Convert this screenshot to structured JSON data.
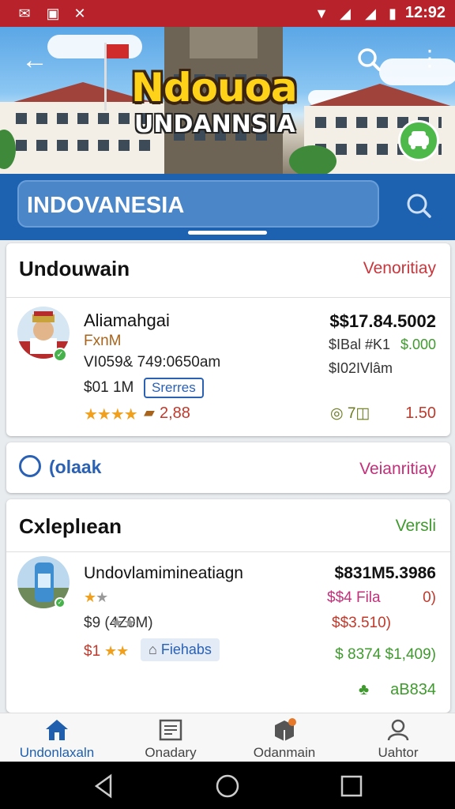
{
  "status_bar": {
    "time": "12:92"
  },
  "hero": {
    "title": "Ndouoa",
    "subtitle": "UNDANNSIA"
  },
  "search": {
    "value": "INDOVANESIA"
  },
  "cards": [
    {
      "header": "Undouwain",
      "side": "Venoritiay",
      "side_color": "#c8363c",
      "item": {
        "name": "Aliamahgai",
        "sub": "FxnM",
        "meta": "VI059&  749:0650am",
        "price_small": "$01 1M",
        "tag": "Srerres",
        "rating_text": "2,88",
        "price_big": "$$17.84.5002",
        "price_row2_a": "$IBal #K1",
        "price_row2_b": "$.000",
        "price_row3": "$I02IVlâm",
        "icons_text": "◎ 7◫",
        "value_right": "1.50"
      }
    },
    {
      "header": "(olaak",
      "side": "Veianritiay",
      "side_color": "#c2307a"
    },
    {
      "header": "Cxleplıean",
      "side": "Versli",
      "side_color": "#3f9a2e",
      "item": {
        "name": "Undovlamimineatiagn",
        "meta": "$9  (4Z0M)",
        "rating_prefix": "$1",
        "tag": "Fiehabs",
        "price_big": "$831M5.3986",
        "price_row2": "$$4 Fila",
        "price_row2_right": "0)",
        "price_row3": "$$3.510)",
        "price_row4": "$ 8374 $1,409)",
        "code": "aB834"
      }
    }
  ],
  "bottom_nav": [
    {
      "label": "Undonlaxaln",
      "icon": "home-icon",
      "active": true
    },
    {
      "label": "Onadary",
      "icon": "newspaper-icon",
      "active": false
    },
    {
      "label": "Odanmain",
      "icon": "box-icon",
      "active": false
    },
    {
      "label": "Uahtor",
      "icon": "user-icon",
      "active": false
    }
  ],
  "colors": {
    "status_red": "#b8232b",
    "primary_blue": "#1c62b0",
    "accent_green": "#4cb94a"
  }
}
